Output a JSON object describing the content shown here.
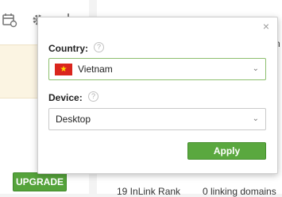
{
  "toolbar": {
    "icons": [
      "calendar-icon",
      "gear-icon",
      "chart-icon"
    ]
  },
  "sidebar": {
    "upgrade_label": "UPGRADE"
  },
  "stats": {
    "inlink_rank": "19 InLink Rank",
    "linking_domains": "0 linking domains"
  },
  "popup": {
    "close_symbol": "×",
    "country": {
      "label": "Country:",
      "help": "?",
      "value": "Vietnam",
      "flag": "vietnam-flag"
    },
    "device": {
      "label": "Device:",
      "help": "?",
      "value": "Desktop"
    },
    "apply_label": "Apply"
  },
  "colors": {
    "accent_green": "#5aa83f",
    "notice_bg": "#fbf4e2"
  }
}
